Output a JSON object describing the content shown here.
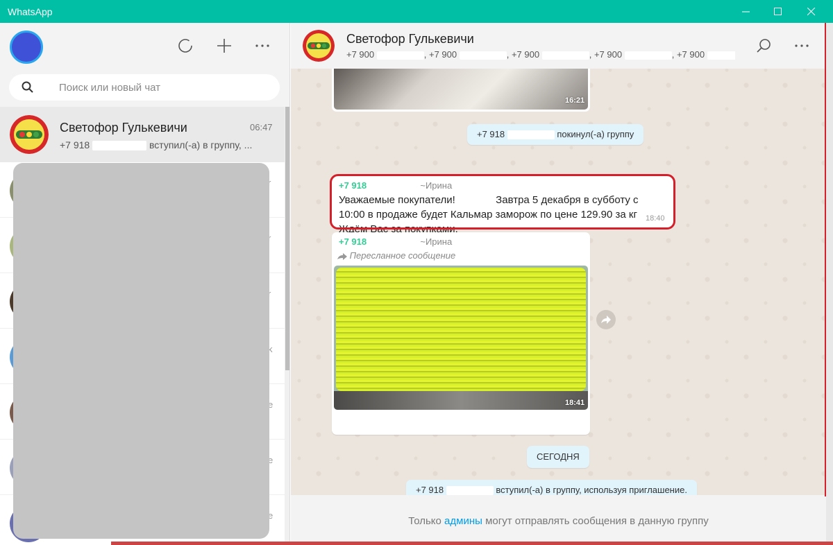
{
  "window": {
    "title": "WhatsApp"
  },
  "sidebar": {
    "search_placeholder": "Поиск или новый чат",
    "chats": [
      {
        "name": "Светофор Гулькевичи",
        "time": "06:47",
        "preview_prefix": "+7 918",
        "preview_suffix": "вступил(-а) в группу, ...",
        "active": true
      }
    ],
    "partial_times": [
      "r",
      "r",
      "r",
      "k",
      "e",
      "e",
      "e"
    ]
  },
  "chat": {
    "name": "Светофор Гулькевичи",
    "members": [
      "+7 900",
      "+7 900",
      "+7 900",
      "+7 900",
      "+7 900"
    ],
    "messages": {
      "img1_time": "16:21",
      "sys_left_prefix": "+7 918",
      "sys_left_suffix": "покинул(-а) группу",
      "m1_sender": "+7 918",
      "m1_sender_name": "~Ирина",
      "m1_text_line1": "Уважаемые покупатели!              Завтра 5 декабря в субботу с",
      "m1_text_line2": "10:00 в продаже будет Кальмар заморож по цене 129.90 за кг",
      "m1_text_line3": "Ждём Вас за покупками.",
      "m1_time": "18:40",
      "m2_sender": "+7 918",
      "m2_sender_name": "~Ирина",
      "m2_forwarded": "Пересланное сообщение",
      "m2_time": "18:41",
      "date_divider": "СЕГОДНЯ",
      "sys_join_prefix": "+7 918",
      "sys_join_suffix": "вступил(-а) в группу, используя приглашение."
    },
    "footer": {
      "before": "Только",
      "link": "админы",
      "after": "могут отправлять сообщения в данную группу"
    }
  },
  "colors": {
    "titlebar": "#00bfa5",
    "highlight": "#d3202a",
    "sender": "#35cd96",
    "link": "#039be5"
  }
}
